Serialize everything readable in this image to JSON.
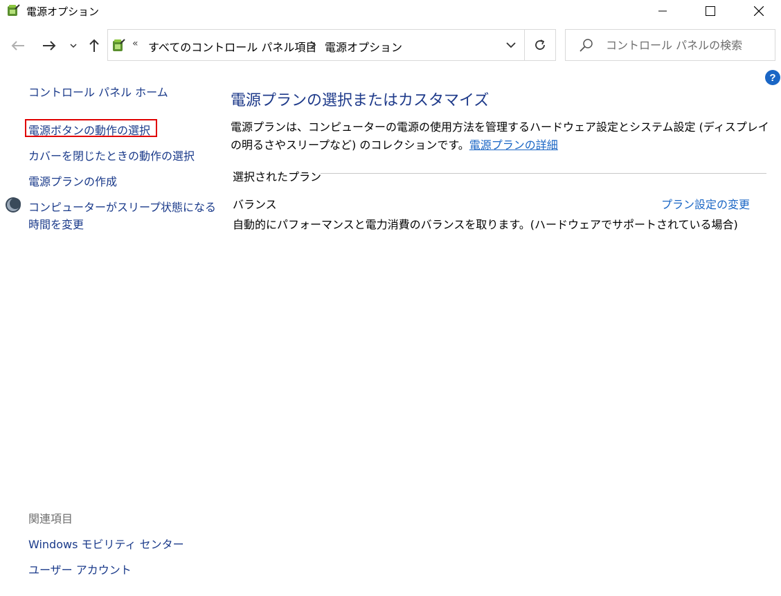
{
  "window": {
    "title": "電源オプション",
    "minimize_icon": "minimize-icon",
    "maximize_icon": "maximize-icon",
    "close_icon": "close-icon"
  },
  "address_bar": {
    "overflow": "«",
    "crumbs": [
      "すべてのコントロール パネル項目",
      "電源オプション"
    ]
  },
  "search": {
    "placeholder": "コントロール パネルの検索"
  },
  "help": {
    "label": "?"
  },
  "left_pane": {
    "home": "コントロール パネル ホーム",
    "links": [
      "電源ボタンの動作の選択",
      "カバーを閉じたときの動作の選択",
      "電源プランの作成"
    ],
    "sleep_link_line1": "コンピューターがスリープ状態になる",
    "sleep_link_line2": "時間を変更",
    "related_title": "関連項目",
    "related": [
      "Windows モビリティ センター",
      "ユーザー アカウント"
    ]
  },
  "main": {
    "title": "電源プランの選択またはカスタマイズ",
    "description": "電源プランは、コンピューターの電源の使用方法を管理するハードウェア設定とシステム設定 (ディスプレイの明るさやスリープなど) のコレクションです。",
    "description_link": "電源プランの詳細",
    "section_label": "選択されたプラン",
    "plan": {
      "name": "バランス",
      "change_link": "プラン設定の変更",
      "description": "自動的にパフォーマンスと電力消費のバランスを取ります。(ハードウェアでサポートされている場合)"
    }
  },
  "colors": {
    "link": "#1a66c5",
    "nav_link": "#1a3a8a",
    "title": "#1e3a8a",
    "highlight": "#e00000"
  }
}
